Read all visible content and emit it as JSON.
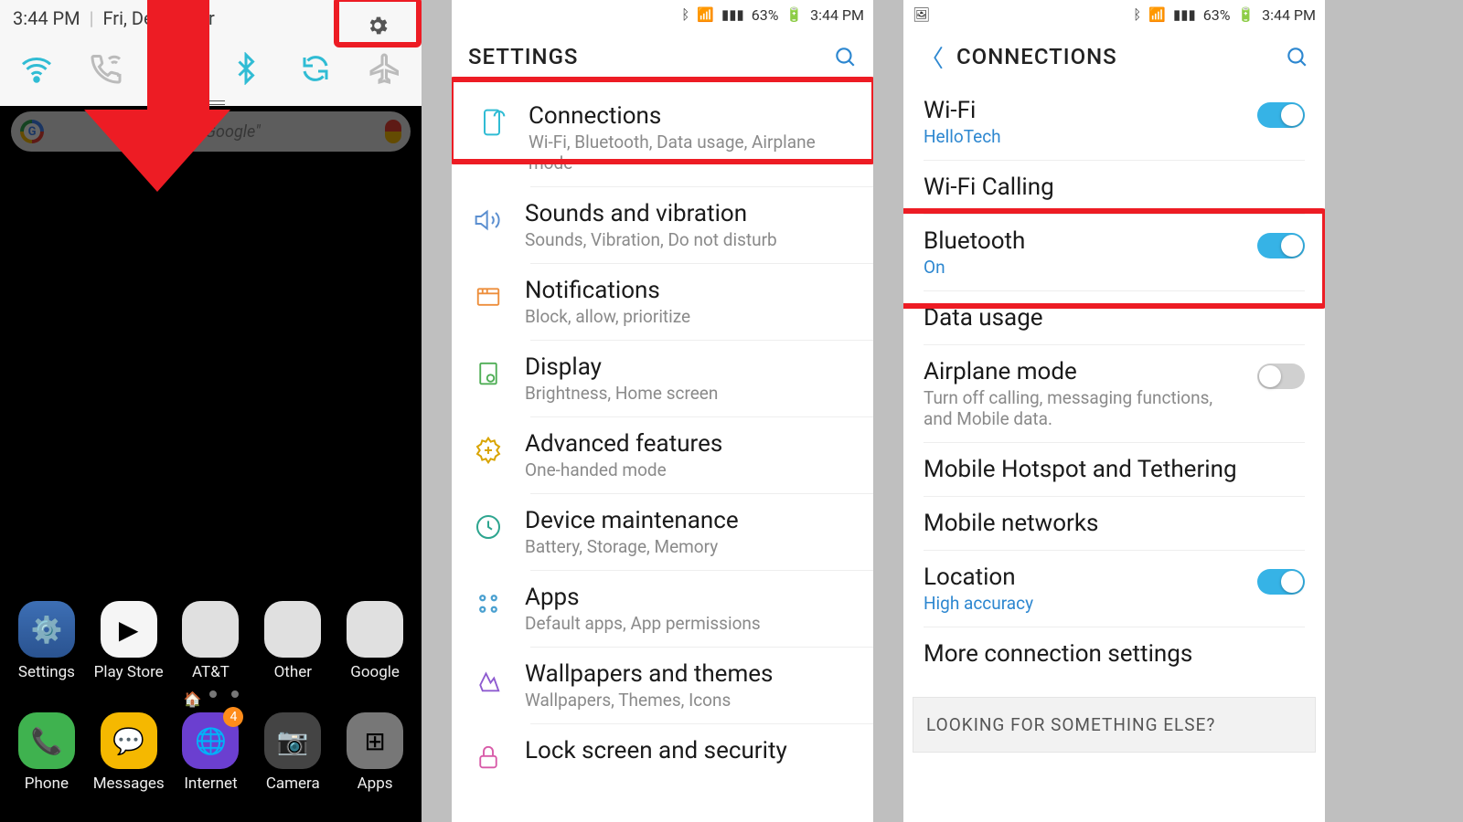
{
  "panel1": {
    "time": "3:44 PM",
    "date": "Fri, December",
    "search_placeholder": "\"Hey Google\"",
    "row1_apps": [
      {
        "label": "Settings"
      },
      {
        "label": "Play Store"
      },
      {
        "label": "AT&T"
      },
      {
        "label": "Other"
      },
      {
        "label": "Google"
      }
    ],
    "row2_apps": [
      {
        "label": "Phone"
      },
      {
        "label": "Messages"
      },
      {
        "label": "Internet",
        "badge": "4"
      },
      {
        "label": "Camera"
      },
      {
        "label": "Apps"
      }
    ]
  },
  "status": {
    "battery": "63%",
    "time": "3:44 PM"
  },
  "panel2": {
    "title": "SETTINGS",
    "items": [
      {
        "title": "Connections",
        "sub": "Wi-Fi, Bluetooth, Data usage, Airplane mode"
      },
      {
        "title": "Sounds and vibration",
        "sub": "Sounds, Vibration, Do not disturb"
      },
      {
        "title": "Notifications",
        "sub": "Block, allow, prioritize"
      },
      {
        "title": "Display",
        "sub": "Brightness, Home screen"
      },
      {
        "title": "Advanced features",
        "sub": "One-handed mode"
      },
      {
        "title": "Device maintenance",
        "sub": "Battery, Storage, Memory"
      },
      {
        "title": "Apps",
        "sub": "Default apps, App permissions"
      },
      {
        "title": "Wallpapers and themes",
        "sub": "Wallpapers, Themes, Icons"
      },
      {
        "title": "Lock screen and security",
        "sub": ""
      }
    ]
  },
  "panel3": {
    "title": "CONNECTIONS",
    "items": [
      {
        "title": "Wi-Fi",
        "sub": "HelloTech",
        "toggle": "on"
      },
      {
        "title": "Wi-Fi Calling"
      },
      {
        "title": "Bluetooth",
        "sub": "On",
        "toggle": "on"
      },
      {
        "title": "Data usage"
      },
      {
        "title": "Airplane mode",
        "sub": "Turn off calling, messaging functions, and Mobile data.",
        "toggle": "off"
      },
      {
        "title": "Mobile Hotspot and Tethering"
      },
      {
        "title": "Mobile networks"
      },
      {
        "title": "Location",
        "sub": "High accuracy",
        "toggle": "on"
      },
      {
        "title": "More connection settings"
      }
    ],
    "footer": "LOOKING FOR SOMETHING ELSE?"
  }
}
